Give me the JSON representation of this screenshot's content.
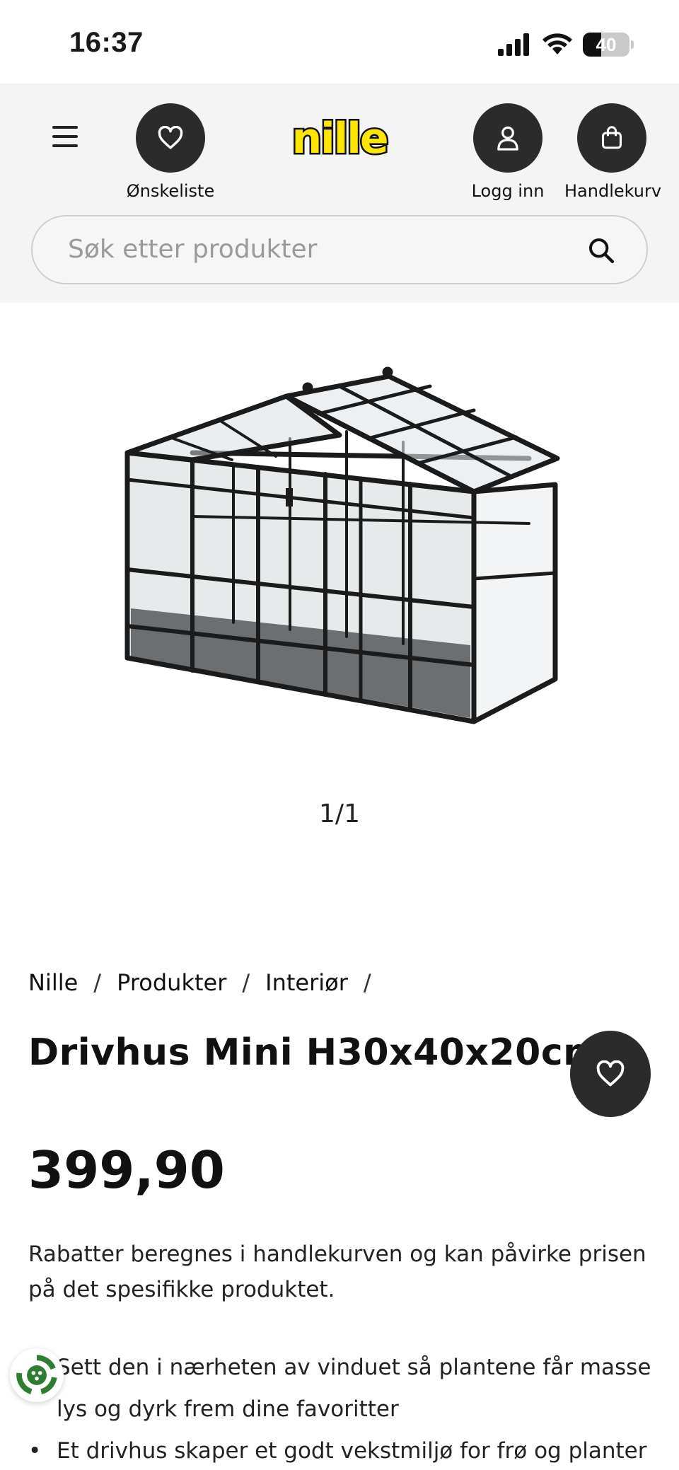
{
  "status_bar": {
    "time": "16:37",
    "battery_percent": 40,
    "battery_label": "40",
    "icons": [
      "signal-icon",
      "wifi-icon",
      "battery-icon"
    ]
  },
  "header": {
    "brand": "nille",
    "wishlist_label": "Ønskeliste",
    "login_label": "Logg inn",
    "cart_label": "Handlekurv",
    "search_placeholder": "Søk etter produkter",
    "colors": {
      "background": "#f4f4f4",
      "button": "#2b2b2b",
      "logo_yellow": "#ffe600"
    }
  },
  "gallery": {
    "pager": "1/1"
  },
  "breadcrumb": [
    "Nille",
    "Produkter",
    "Interiør"
  ],
  "product": {
    "title": "Drivhus Mini H30x40x20cm",
    "price": "399,90",
    "discount_note": "Rabatter beregnes i handlekurven og kan påvirke prisen på det spesifikke produktet.",
    "bullets": [
      "Sett den i nærheten av vinduet så plantene får masse",
      "lys og dyrk frem dine favoritter",
      "Et drivhus skaper et godt vekstmiljø for frø og planter"
    ]
  }
}
